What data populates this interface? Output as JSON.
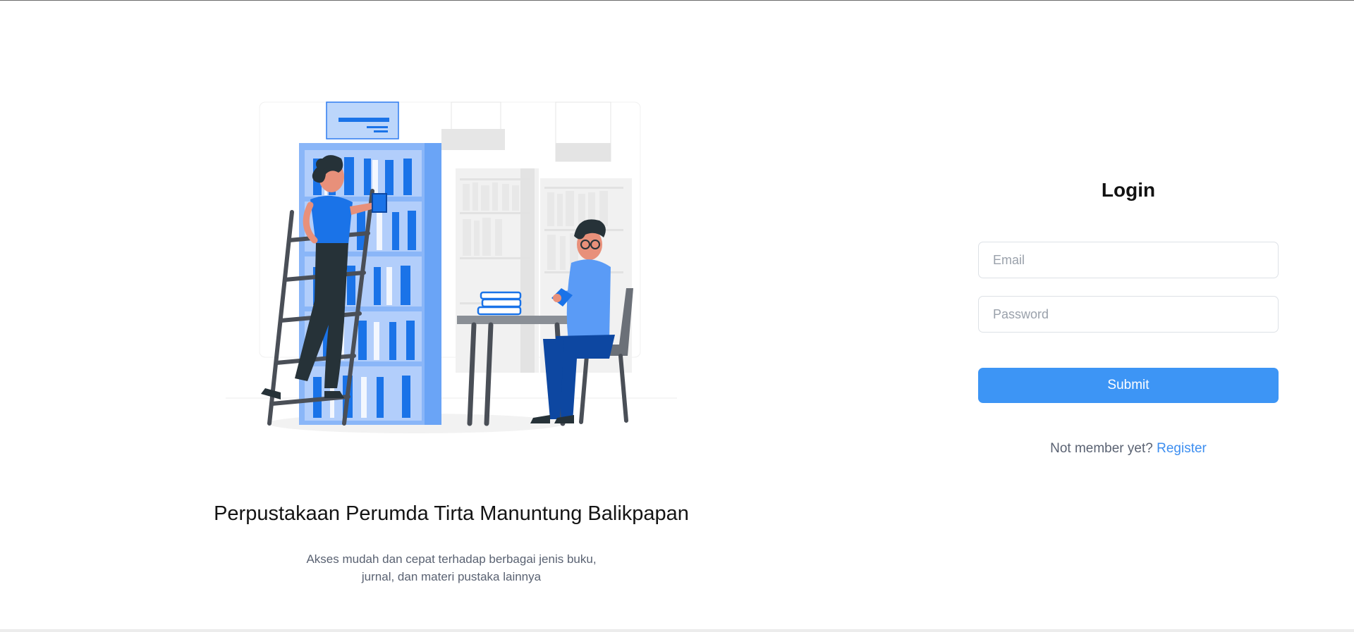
{
  "promo": {
    "title": "Perpustakaan Perumda Tirta Manuntung Balikpapan",
    "description": "Akses mudah dan cepat terhadap berbagai jenis buku, jurnal, dan materi pustaka lainnya"
  },
  "login": {
    "title": "Login",
    "email_placeholder": "Email",
    "password_placeholder": "Password",
    "submit_label": "Submit",
    "register_prompt": "Not member yet?",
    "register_link": "Register"
  },
  "colors": {
    "accent": "#3d95f5",
    "link": "#3d8ef0",
    "illustration_blue": "#1a73e8"
  },
  "illustration": {
    "icon": "library-reading-illustration"
  }
}
